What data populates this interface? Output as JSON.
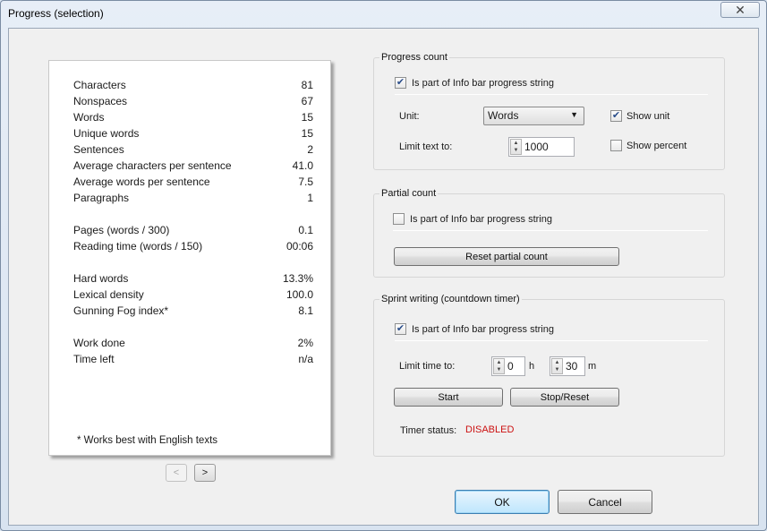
{
  "window": {
    "title": "Progress (selection)",
    "close_glyph": "✕"
  },
  "stats": {
    "rows": [
      {
        "label": "Characters",
        "value": "81"
      },
      {
        "label": "Nonspaces",
        "value": "67"
      },
      {
        "label": "Words",
        "value": "15"
      },
      {
        "label": "Unique words",
        "value": "15"
      },
      {
        "label": "Sentences",
        "value": "2"
      },
      {
        "label": "Average characters per sentence",
        "value": "41.0"
      },
      {
        "label": "Average words per sentence",
        "value": "7.5"
      },
      {
        "label": "Paragraphs",
        "value": "1"
      },
      {
        "label": "Pages (words / 300)",
        "value": "0.1"
      },
      {
        "label": "Reading time (words / 150)",
        "value": "00:06"
      },
      {
        "label": "Hard words",
        "value": "13.3%"
      },
      {
        "label": "Lexical density",
        "value": "100.0"
      },
      {
        "label": "Gunning Fog index*",
        "value": "8.1"
      },
      {
        "label": "Work done",
        "value": "2%"
      },
      {
        "label": "Time left",
        "value": "n/a"
      }
    ],
    "footnote": "* Works best with English texts",
    "prev_glyph": "<",
    "next_glyph": ">"
  },
  "progress_count": {
    "title": "Progress count",
    "infobar_label": "Is part of Info bar progress string",
    "infobar_checked": true,
    "unit_label": "Unit:",
    "unit_value": "Words",
    "show_unit_label": "Show unit",
    "show_unit_checked": true,
    "limit_label": "Limit text to:",
    "limit_value": "1000",
    "show_percent_label": "Show percent",
    "show_percent_checked": false
  },
  "partial_count": {
    "title": "Partial count",
    "infobar_label": "Is part of Info bar progress string",
    "infobar_checked": false,
    "reset_label": "Reset partial count"
  },
  "sprint": {
    "title": "Sprint writing (countdown timer)",
    "infobar_label": "Is part of Info bar progress string",
    "infobar_checked": true,
    "limit_label": "Limit time to:",
    "hours_value": "0",
    "hours_unit": "h",
    "minutes_value": "30",
    "minutes_unit": "m",
    "start_label": "Start",
    "stop_label": "Stop/Reset",
    "status_label": "Timer status:",
    "status_value": "DISABLED"
  },
  "dialog_buttons": {
    "ok_label": "OK",
    "cancel_label": "Cancel"
  },
  "colors": {
    "status_disabled": "#cc1111",
    "check_mark": "#2a4d8a"
  },
  "glyphs": {
    "check": "✔",
    "spin_up": "▲",
    "spin_down": "▼",
    "dropdown": "▼"
  }
}
